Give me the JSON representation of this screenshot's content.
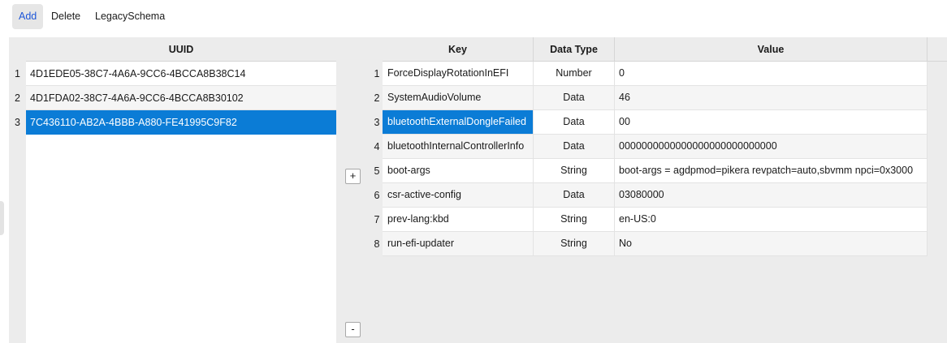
{
  "toolbar": {
    "add": "Add",
    "delete": "Delete",
    "legacy": "LegacySchema"
  },
  "left_table": {
    "header": "UUID",
    "rows": [
      {
        "num": "1",
        "uuid": "4D1EDE05-38C7-4A6A-9CC6-4BCCA8B38C14"
      },
      {
        "num": "2",
        "uuid": "4D1FDA02-38C7-4A6A-9CC6-4BCCA8B30102"
      },
      {
        "num": "3",
        "uuid": "7C436110-AB2A-4BBB-A880-FE41995C9F82"
      }
    ]
  },
  "buttons": {
    "plus": "+",
    "minus": "-"
  },
  "right_table": {
    "headers": {
      "key": "Key",
      "type": "Data Type",
      "value": "Value"
    },
    "rows": [
      {
        "num": "1",
        "key": "ForceDisplayRotationInEFI",
        "type": "Number",
        "value": "0"
      },
      {
        "num": "2",
        "key": "SystemAudioVolume",
        "type": "Data",
        "value": "46"
      },
      {
        "num": "3",
        "key": "bluetoothExternalDongleFailed",
        "type": "Data",
        "value": "00"
      },
      {
        "num": "4",
        "key": "bluetoothInternalControllerInfo",
        "type": "Data",
        "value": "0000000000000000000000000000"
      },
      {
        "num": "5",
        "key": "boot-args",
        "type": "String",
        "value": "boot-args = agdpmod=pikera revpatch=auto,sbvmm npci=0x3000"
      },
      {
        "num": "6",
        "key": "csr-active-config",
        "type": "Data",
        "value": "03080000"
      },
      {
        "num": "7",
        "key": "prev-lang:kbd",
        "type": "String",
        "value": "en-US:0"
      },
      {
        "num": "8",
        "key": "run-efi-updater",
        "type": "String",
        "value": "No"
      }
    ]
  }
}
